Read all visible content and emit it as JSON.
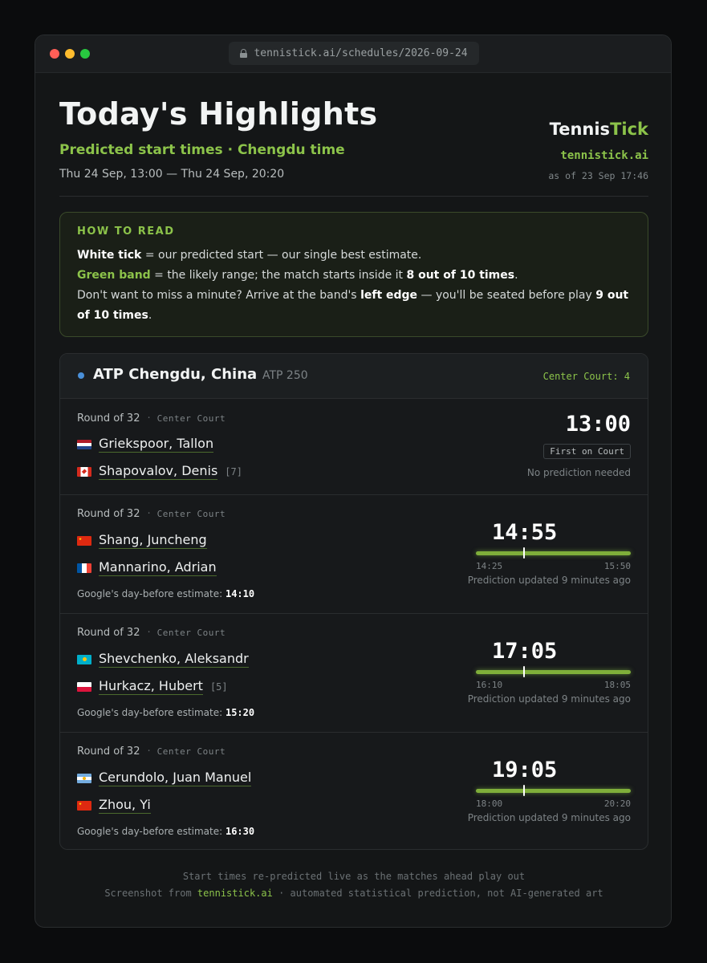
{
  "browser": {
    "url": "tennistick.ai/schedules/2026-09-24"
  },
  "header": {
    "title": "Today's Highlights",
    "subtitle": "Predicted start times · Chengdu time",
    "range": "Thu 24 Sep, 13:00 — Thu 24 Sep, 20:20",
    "brand_part1": "Tennis",
    "brand_part2": "Tick",
    "brand_url": "tennistick.ai",
    "as_of": "as of 23 Sep 17:46"
  },
  "how_to_read": {
    "title": "HOW TO READ",
    "l1_b": "White tick",
    "l1_t": " = our predicted start — our single best estimate.",
    "l2_g": "Green band",
    "l2_t": " = the likely range; the match starts inside it ",
    "l2_b": "8 out of 10 times",
    "l2_e": ".",
    "l3_t1": "Don't want to miss a minute? Arrive at the band's ",
    "l3_b1": "left edge",
    "l3_t2": " — you'll be seated before play ",
    "l3_b2": "9 out of 10 times",
    "l3_e": "."
  },
  "tournament": {
    "name": "ATP Chengdu, China",
    "category": "ATP 250",
    "court_label": "Center Court: 4"
  },
  "matches": [
    {
      "round": "Round of 32",
      "court": "Center Court",
      "p1": "Griekspoor, Tallon",
      "p1_flag": "netherlands-flag-icon",
      "p2": "Shapovalov, Denis",
      "p2_seed": "[7]",
      "p2_flag": "canada-flag-icon",
      "time": "13:00",
      "badge": "First on Court",
      "note": "No prediction needed"
    },
    {
      "round": "Round of 32",
      "court": "Center Court",
      "p1": "Shang, Juncheng",
      "p1_flag": "china-flag-icon",
      "p2": "Mannarino, Adrian",
      "p2_flag": "france-flag-icon",
      "google_label": "Google's day-before estimate:",
      "google_value": "14:10",
      "time": "14:55",
      "band_lo": "14:25",
      "band_hi": "15:50",
      "updated": "Prediction updated 9 minutes ago"
    },
    {
      "round": "Round of 32",
      "court": "Center Court",
      "p1": "Shevchenko, Aleksandr",
      "p1_flag": "kazakhstan-flag-icon",
      "p2": "Hurkacz, Hubert",
      "p2_seed": "[5]",
      "p2_flag": "poland-flag-icon",
      "google_label": "Google's day-before estimate:",
      "google_value": "15:20",
      "time": "17:05",
      "band_lo": "16:10",
      "band_hi": "18:05",
      "updated": "Prediction updated 9 minutes ago"
    },
    {
      "round": "Round of 32",
      "court": "Center Court",
      "p1": "Cerundolo, Juan Manuel",
      "p1_flag": "argentina-flag-icon",
      "p2": "Zhou, Yi",
      "p2_flag": "china-flag-icon",
      "google_label": "Google's day-before estimate:",
      "google_value": "16:30",
      "time": "19:05",
      "band_lo": "18:00",
      "band_hi": "20:20",
      "updated": "Prediction updated 9 minutes ago"
    }
  ],
  "footer": {
    "line1": "Start times re-predicted live as the matches ahead play out",
    "line2_a": "Screenshot from ",
    "line2_link": "tennistick.ai",
    "line2_b": " · automated statistical prediction, not AI-generated art"
  },
  "colors": {
    "accent": "#8cc34a",
    "tournament_dot": "#4a90d9"
  }
}
